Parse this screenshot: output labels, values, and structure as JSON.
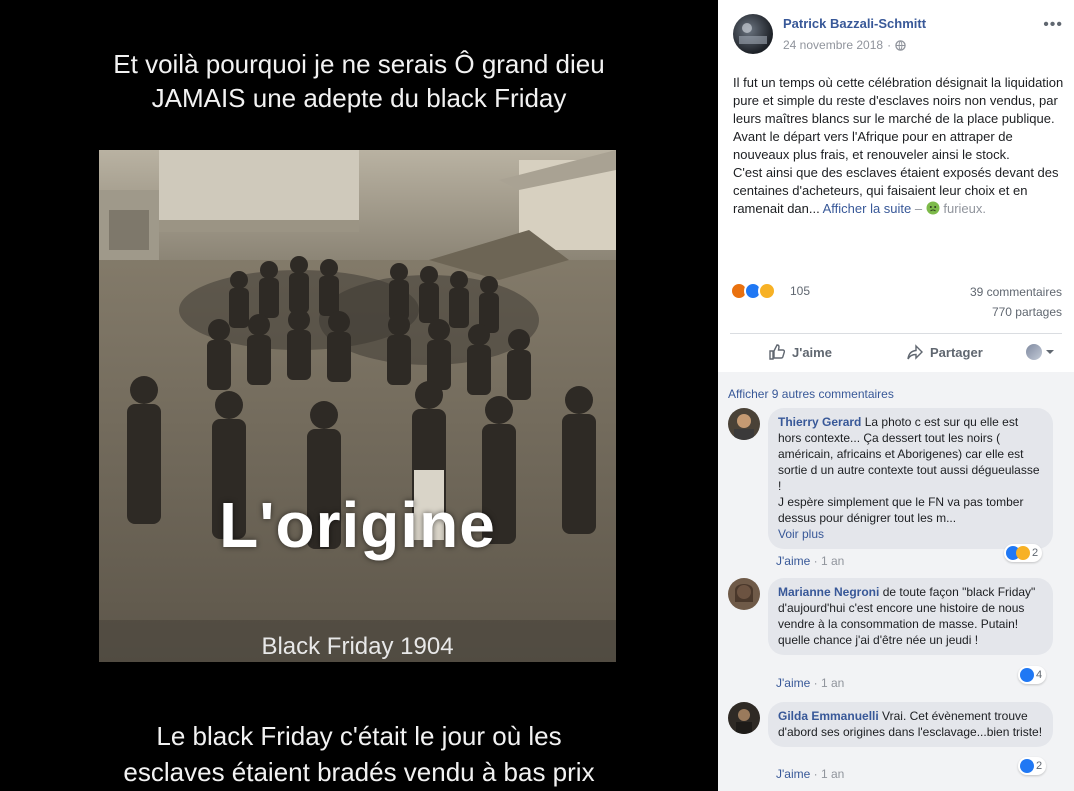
{
  "photo": {
    "caption_top": [
      "Et voilà pourquoi je ne serais Ô grand dieu",
      "JAMAIS une adepte du black Friday"
    ],
    "image_title": "L'origine",
    "image_subtitle": "Black Friday 1904",
    "caption_bottom": [
      "Le black Friday c'était le jour où les",
      "esclaves étaient bradés vendu à bas prix"
    ]
  },
  "post": {
    "author": "Patrick Bazzali-Schmitt",
    "date": "24 novembre 2018",
    "audience_icon": "globe-icon",
    "more_icon": "more-icon",
    "text_lines": [
      "Il fut un temps où cette célébration désignait la liquidation pure et simple du reste d'esclaves noirs non vendus, par leurs maîtres blancs sur le marché de la place publique. Avant le départ vers l'Afrique pour en attraper de nouveaux plus frais, et renouveler ainsi le stock.",
      "C'est ainsi que des esclaves étaient exposés devant des centaines d'acheteurs, qui faisaient leur choix et en ramenait dan..."
    ],
    "see_more": "Afficher la suite",
    "feeling_separator": "–",
    "feeling_icon": "furious-face-icon",
    "feeling": "furieux."
  },
  "stats": {
    "reaction_icons": [
      "angry-icon",
      "like-icon",
      "sad-icon"
    ],
    "reaction_count": "105",
    "comments": "39 commentaires",
    "shares": "770 partages"
  },
  "actions": {
    "like": "J'aime",
    "share": "Partager"
  },
  "comments_section": {
    "previous": "Afficher 9 autres commentaires",
    "items": [
      {
        "name": "Thierry Gerard",
        "text": "La photo c est sur qu elle est hors contexte... Ça dessert tout les noirs ( américain, africains et Aborigenes) car elle est sortie d un autre contexte tout aussi dégueulasse !",
        "text2": "J espère simplement que le FN va pas tomber dessus pour dénigrer tout les m...",
        "see_more": "Voir plus",
        "like_label": "J'aime",
        "time": "1 an",
        "reaction_count": "2"
      },
      {
        "name": "Marianne Negroni",
        "text": "de toute façon \"black Friday\" d'aujourd'hui c'est encore une histoire de nous vendre à la consommation de masse. Putain! quelle chance j'ai d'être née un jeudi !",
        "like_label": "J'aime",
        "time": "1 an",
        "reaction_count": "4"
      },
      {
        "name": "Gilda Emmanuelli",
        "text": "Vrai. Cet évènement trouve d'abord ses origines dans l'esclavage...bien triste!",
        "like_label": "J'aime",
        "time": "1 an",
        "reaction_count": "2"
      }
    ]
  }
}
